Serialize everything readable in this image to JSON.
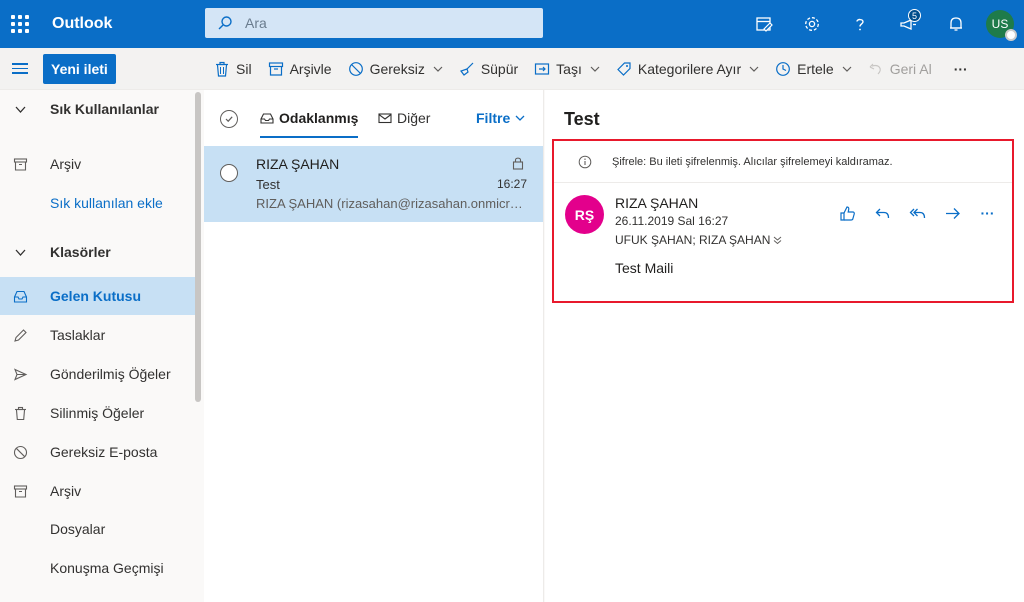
{
  "app": {
    "title": "Outlook"
  },
  "search": {
    "placeholder": "Ara"
  },
  "topbar": {
    "notification_badge": "5",
    "user_initials": "US"
  },
  "command_bar": {
    "new_message": "Yeni ileti",
    "delete": "Sil",
    "archive": "Arşivle",
    "junk": "Gereksiz",
    "sweep": "Süpür",
    "move": "Taşı",
    "categorize": "Kategorilere Ayır",
    "snooze": "Ertele",
    "undo": "Geri Al",
    "more": "···"
  },
  "nav": {
    "favorites_header": "Sık Kullanılanlar",
    "favorites": [
      {
        "label": "Arşiv"
      }
    ],
    "add_favorite": "Sık kullanılan ekle",
    "folders_header": "Klasörler",
    "folders": [
      {
        "label": "Gelen Kutusu"
      },
      {
        "label": "Taslaklar"
      },
      {
        "label": "Gönderilmiş Öğeler"
      },
      {
        "label": "Silinmiş Öğeler"
      },
      {
        "label": "Gereksiz E-posta"
      },
      {
        "label": "Arşiv"
      },
      {
        "label": "Dosyalar"
      },
      {
        "label": "Konuşma Geçmişi"
      }
    ]
  },
  "message_list": {
    "tab_focused": "Odaklanmış",
    "tab_other": "Diğer",
    "filter": "Filtre",
    "messages": [
      {
        "from": "RIZA ŞAHAN",
        "subject": "Test",
        "time": "16:27",
        "preview": "RIZA ŞAHAN (rizasahan@rizasahan.onmicrosoft.com)"
      }
    ]
  },
  "reading_pane": {
    "subject": "Test",
    "encryption_notice": "Şifrele: Bu ileti şifrelenmiş. Alıcılar şifrelemeyi kaldıramaz.",
    "sender_initials": "RŞ",
    "sender_name": "RIZA ŞAHAN",
    "date": "26.11.2019 Sal 16:27",
    "recipients": "UFUK ŞAHAN; RIZA ŞAHAN",
    "body": "Test Maili",
    "more": "···"
  },
  "colors": {
    "accent": "#0a6ec7",
    "selected": "#c7e0f4",
    "sender_avatar": "#e3008c",
    "highlight_border": "#e8192c"
  }
}
